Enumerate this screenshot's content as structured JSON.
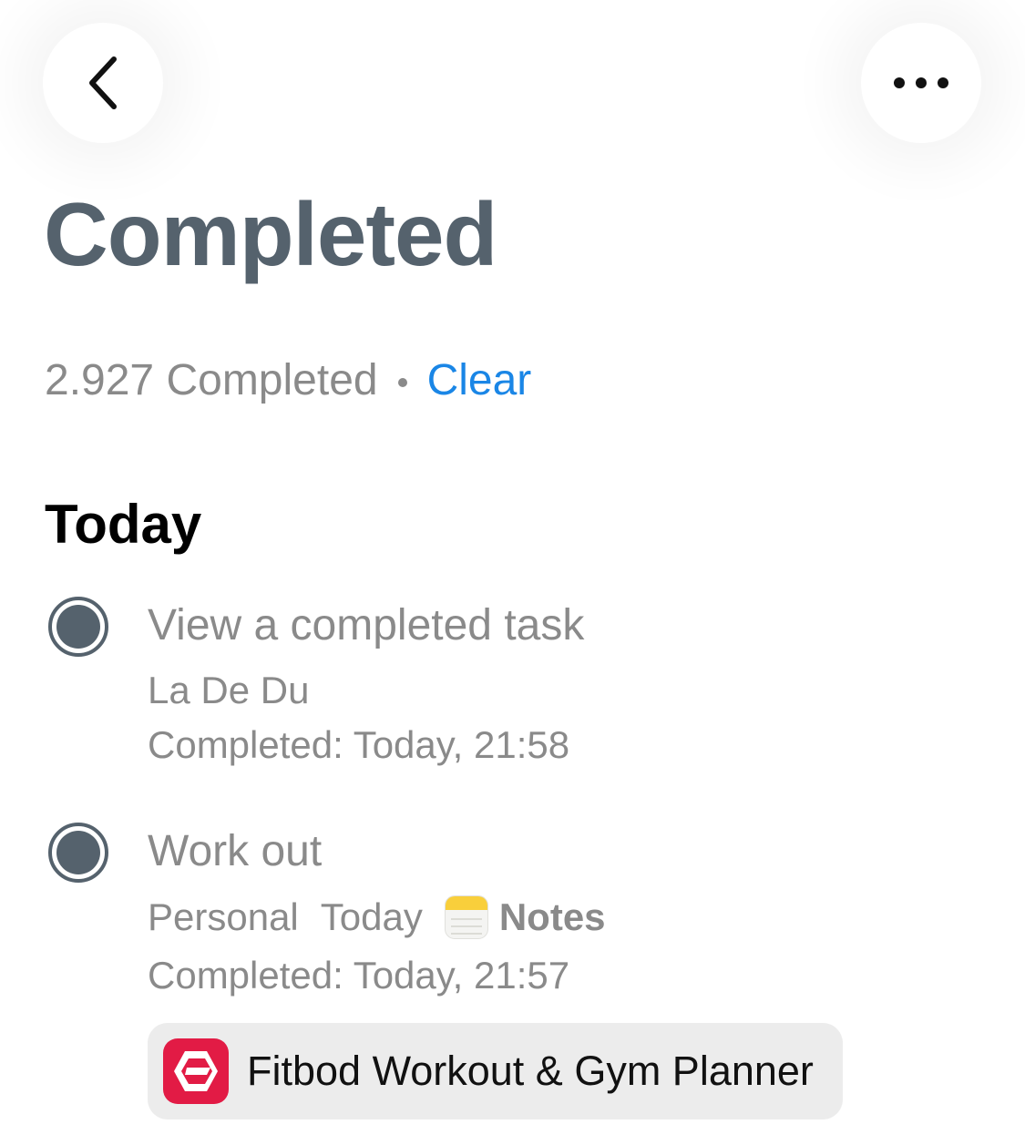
{
  "header": {
    "back_icon": "chevron-left-icon",
    "more_icon": "ellipsis-horizontal-icon"
  },
  "page": {
    "title": "Completed",
    "completed_count_label": "2.927 Completed",
    "clear_label": "Clear"
  },
  "sections": [
    {
      "heading": "Today",
      "tasks": [
        {
          "title": "View a completed task",
          "project": "La De Du",
          "completed_at": "Completed: Today, 21:58"
        },
        {
          "title": "Work out",
          "project": "Personal",
          "due": "Today",
          "source_label": "Notes",
          "completed_at": "Completed: Today, 21:57",
          "app": {
            "name": "Fitbod Workout & Gym Planner"
          }
        }
      ]
    }
  ],
  "colors": {
    "accent_link": "#1a86e6",
    "title": "#55626d",
    "secondary_text": "#8a8a8a",
    "app_icon_red": "#e21b45"
  }
}
